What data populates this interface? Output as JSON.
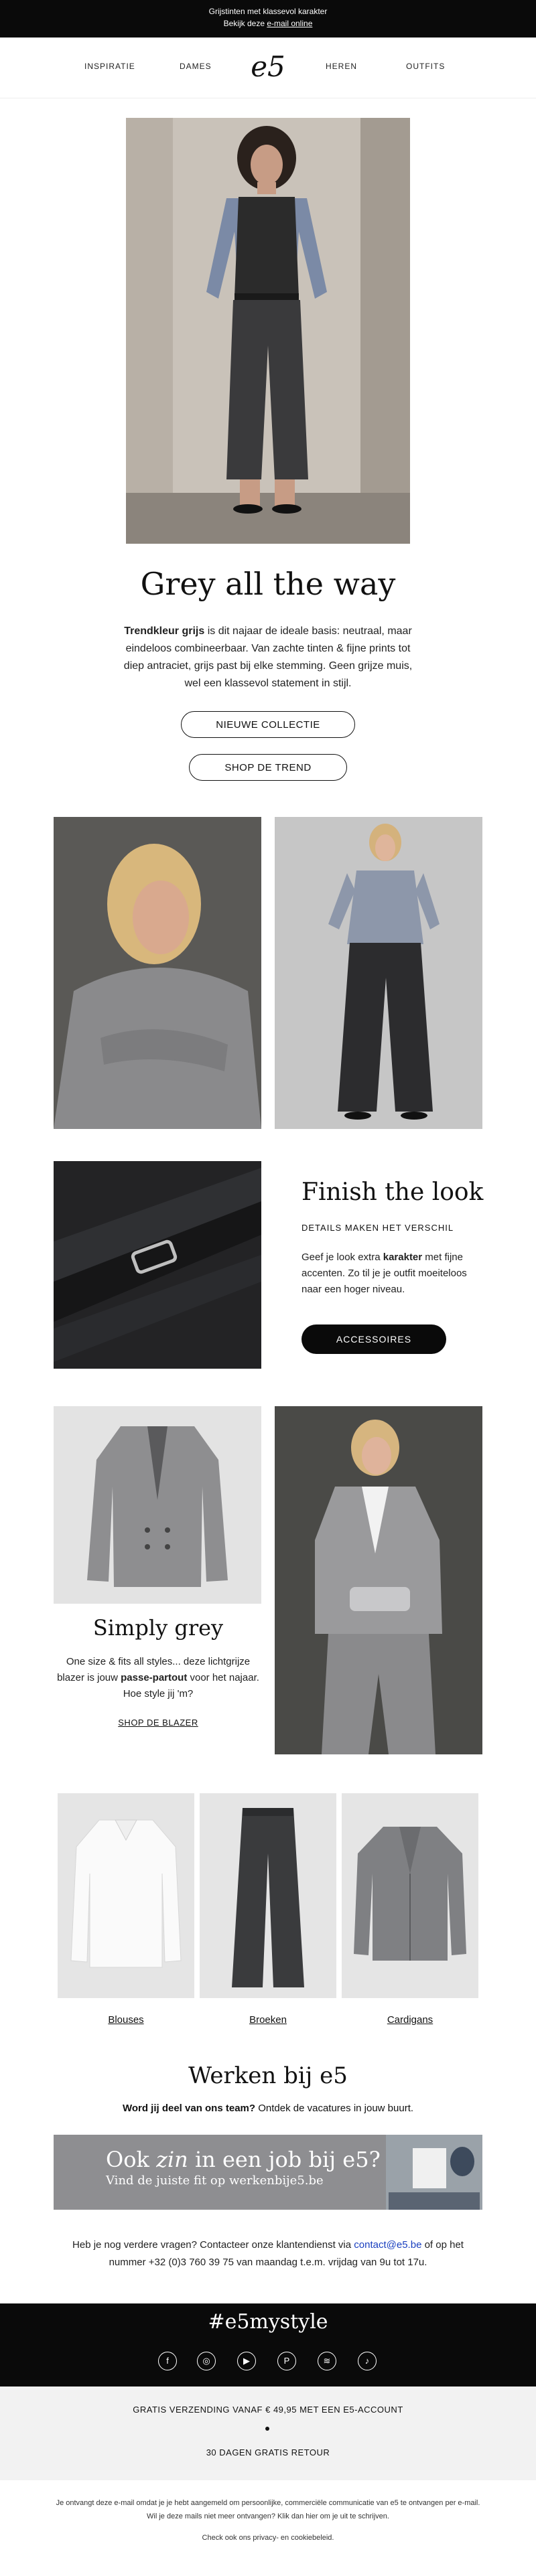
{
  "topbar": {
    "line1": "Grijstinten met klassevol karakter",
    "line2_prefix": "Bekijk deze ",
    "line2_link": "e-mail online"
  },
  "nav": {
    "items": [
      "INSPIRATIE",
      "DAMES",
      "HEREN",
      "OUTFITS"
    ],
    "logo": "e5"
  },
  "hero": {
    "headline": "Grey all the way",
    "intro_bold": "Trendkleur grijs",
    "intro_rest": " is dit najaar de ideale basis: neutraal, maar eindeloos combineerbaar. Van zachte tinten & fijne prints tot diep antraciet, grijs past bij elke stemming. Geen grijze muis, wel een klassevol statement in stijl.",
    "button1": "NIEUWE COLLECTIE",
    "button2": "SHOP DE TREND"
  },
  "finish": {
    "title": "Finish the look",
    "subtitle": "DETAILS MAKEN HET VERSCHIL",
    "text_prefix": "Geef je look extra ",
    "text_bold": "karakter",
    "text_rest": " met fijne accenten. Zo til je je outfit moeiteloos naar een hoger niveau.",
    "button": "ACCESSOIRES"
  },
  "simply": {
    "title": "Simply grey",
    "text_prefix": "One size & fits all styles... deze lichtgrijze blazer is jouw ",
    "text_bold": "passe-partout",
    "text_rest": " voor het najaar. Hoe style jij 'm?",
    "link": "SHOP DE BLAZER"
  },
  "products": {
    "labels": [
      "Blouses",
      "Broeken",
      "Cardigans"
    ]
  },
  "werken": {
    "title": "Werken bij e5",
    "text_bold": "Word jij deel van ons team?",
    "text_mid": " Ontdek de ",
    "text_link": "vacatures",
    "text_rest": " in jouw buurt.",
    "banner_title_prefix": "Ook ",
    "banner_title_italic": "zin",
    "banner_title_rest": " in een job bij e5?",
    "banner_sub_prefix": "Vind de juiste fit op ",
    "banner_sub_link": "werkenbije5.be"
  },
  "contact": {
    "prefix": "Heb je nog verdere vragen? Contacteer onze klantendienst via ",
    "email": "contact@e5.be",
    "rest": " of op het nummer +32 (0)3 760 39 75 van maandag t.e.m. vrijdag van 9u tot 17u."
  },
  "social": {
    "hashtag": "#e5mystyle",
    "icons": [
      "facebook-icon",
      "instagram-icon",
      "youtube-icon",
      "pinterest-icon",
      "spotify-icon",
      "tiktok-icon"
    ]
  },
  "shipping": {
    "line1": "GRATIS VERZENDING VANAF € 49,95 MET EEN E5-ACCOUNT",
    "line2": "30 DAGEN GRATIS RETOUR"
  },
  "footer": {
    "text_prefix": "Je ontvangt deze e-mail omdat je je hebt aangemeld om persoonlijke, commerciële communicatie van e5 te ontvangen per e-mail. Wil je deze mails niet meer ontvangen? Klik dan hier om je ",
    "unsubscribe": "uit te schrijven",
    "text_end": ".",
    "privacy_prefix": "Check ook ons ",
    "privacy_link": "privacy- en cookiebeleid",
    "privacy_end": "."
  }
}
